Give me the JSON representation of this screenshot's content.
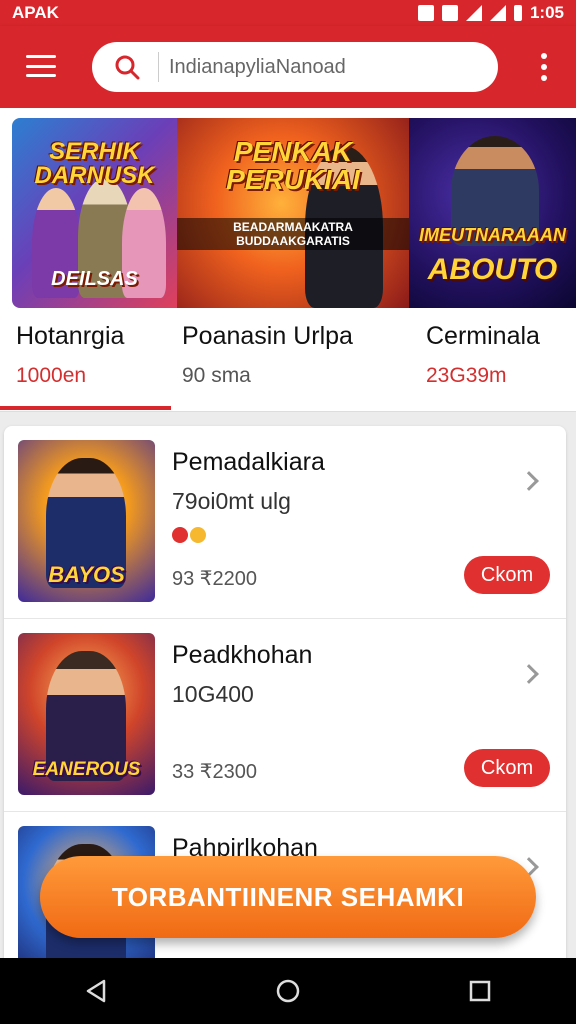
{
  "statusbar": {
    "carrier": "APAK",
    "time": "1:05"
  },
  "appbar": {
    "search_placeholder": "IndianapyliaNanoad"
  },
  "featured": {
    "banners": [
      {
        "title": "SERHIK DARNUSK",
        "bottom": "DEILSAS"
      },
      {
        "title": "PENKAK PERUKIAI",
        "sub": "BEADARMAAKATRA BUDDAAKGARATIS"
      },
      {
        "title": "IMEUTNARAAAN",
        "bottom": "ABOUTO"
      }
    ],
    "items": [
      {
        "name": "Hotanrgia",
        "meta": "1000en"
      },
      {
        "name": "Poanasin Urlpa",
        "meta": "90 sma"
      },
      {
        "name": "Cerminala",
        "meta": "23G39m"
      }
    ]
  },
  "list": [
    {
      "thumb": "BAYOS",
      "title": "Pemadalkiara",
      "subtitle": "79oi0mt ulg",
      "price": "93 ₹2200",
      "button": "Ckom"
    },
    {
      "thumb": "EANEROUS",
      "title": "Peadkhohan",
      "subtitle": "10G400",
      "price": "33 ₹2300",
      "button": "Ckom"
    },
    {
      "thumb": "",
      "title": "Pahpirlkohan",
      "subtitle": "",
      "price": "",
      "button": ""
    }
  ],
  "cta": {
    "label": "TORBANTIINENR SEHAMKI"
  },
  "colors": {
    "brand_red": "#d7262c",
    "cta_orange": "#f07a1e"
  }
}
